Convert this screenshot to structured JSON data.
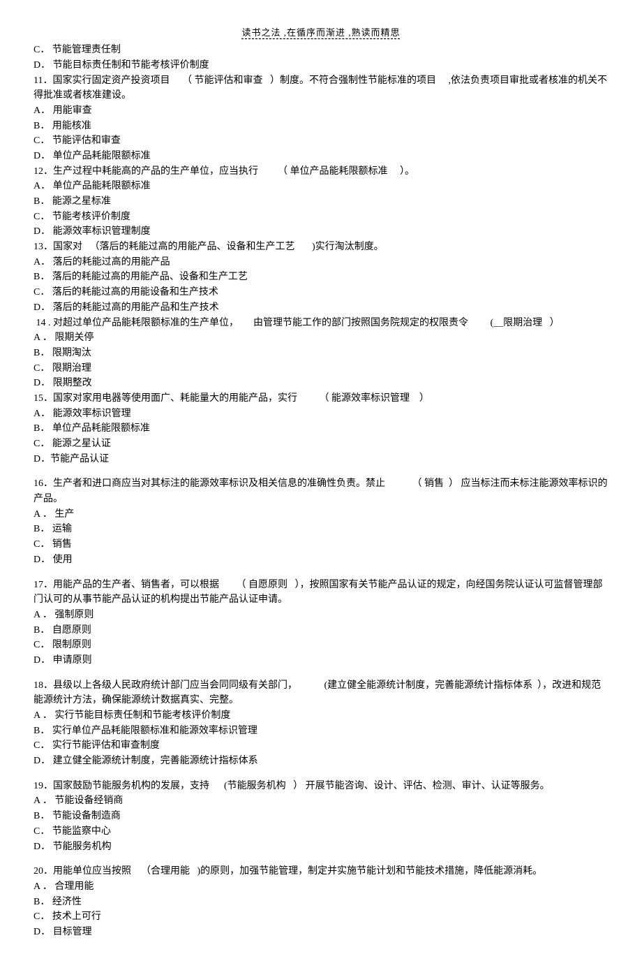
{
  "header_note": "读书之法 ,在循序而渐进 ,熟读而精思",
  "orphan_options": {
    "c": "C．  节能管理责任制",
    "d": "D．  节能目标责任制和节能考核评价制度"
  },
  "q11": {
    "stem": "11．国家实行固定资产投资项目     （ 节能评估和审查   ）制度。不符合强制性节能标准的项目     ,依法负责项目审批或者核准的机关不得批准或者核准建设。",
    "a": "A．  用能审查",
    "b": "B．  用能核准",
    "c": "C．  节能评估和审查",
    "d": "D．  单位产品耗能限额标准"
  },
  "q12": {
    "stem": "12．生产过程中耗能高的产品的生产单位，应当执行        （ 单位产品能耗限额标准     ）。",
    "a": "A．  单位产品能耗限额标准",
    "b": "B．  能源之星标准",
    "c": "C．  节能考核评价制度",
    "d": "D．  能源效率标识管理制度"
  },
  "q13": {
    "stem": "13．国家对   （落后的耗能过高的用能产品、设备和生产工艺       )实行淘汰制度。",
    "a": "A． 落后的耗能过高的用能产品",
    "b": "B．  落后的耗能过高的用能产品、设备和生产工艺",
    "c": "C．  落后的耗能过高的用能设备和生产技术",
    "d": "D．  落后的耗能过高的用能产品和生产技术"
  },
  "q14": {
    "stem": " 14 . 对超过单位产品能耗限额标准的生产单位，      由管理节能工作的部门按照国务院规定的权限责令         (＿限期治理   ）",
    "a": "A ．  限期关停",
    "b": "B．  限期淘汰",
    "c": "C．  限期治理",
    "d": "D．  限期整改"
  },
  "q15": {
    "stem": "15．国家对家用电器等使用面广、耗能量大的用能产品，实行         （ 能源效率标识管理    ）",
    "a": "A．  能源效率标识管理",
    "b": "B．  单位产品耗能限额标准",
    "c": "C．  能源之星认证",
    "d": "D．节能产品认证"
  },
  "q16": {
    "stem": "16．生产者和进口商应当对其标注的能源效率标识及相关信息的准确性负责。禁止           （ 销售  ） 应当标注而未标注能源效率标识的产品。",
    "a": "A ．  生产",
    "b": "B．  运输",
    "c": "C．  销售",
    "d": "D．  使用"
  },
  "q17": {
    "stem": "17．用能产品的生产者、销售者，可以根据       （ 自愿原则   ），按照国家有关节能产品认证的规定，向经国务院认证认可监督管理部门认可的从事节能产品认证的机构提出节能产品认证申请。",
    "a": "A ．  强制原则",
    "b": "B．  自愿原则",
    "c": "C．  限制原则",
    "d": "D．  申请原则"
  },
  "q18": {
    "stem": "18．县级以上各级人民政府统计部门应当会同同级有关部门，           (建立健全能源统计制度，完善能源统计指标体系  ），改进和规范能源统计方法，确保能源统计数据真实、完整。",
    "a": "A ．  实行节能目标责任制和节能考核评价制度",
    "b": "B．  实行单位产品耗能限额标准和能源效率标识管理",
    "c": "C．  实行节能评估和审查制度",
    "d": "D．  建立健全能源统计制度，完善能源统计指标体系"
  },
  "q19": {
    "stem": "19．国家鼓励节能服务机构的发展，支持      (节能服务机构   ） 开展节能咨询、设计、评估、检测、审计、认证等服务。",
    "a": "A ．  节能设备经销商",
    "b": "B．  节能设备制造商",
    "c": "C．  节能监察中心",
    "d": "D．  节能服务机构"
  },
  "q20": {
    "stem": "20．用能单位应当按照    （合理用能   )的原则，加强节能管理，制定并实施节能计划和节能技术措施，降低能源消耗。",
    "a": "A ．  合理用能",
    "b": "B．  经济性",
    "c": "C．  技术上可行",
    "d": "D．  目标管理"
  }
}
